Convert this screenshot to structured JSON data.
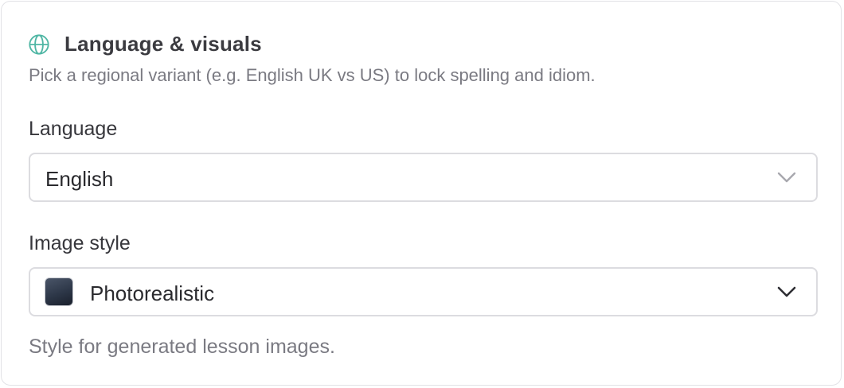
{
  "section": {
    "title": "Language & visuals",
    "subtitle": "Pick a regional variant (e.g. English UK vs US) to lock spelling and idiom.",
    "icon": "globe-icon",
    "accent_color": "#4fb6a4"
  },
  "language": {
    "label": "Language",
    "selected": "English"
  },
  "image_style": {
    "label": "Image style",
    "selected": "Photorealistic",
    "swatch_color": "#2d3748",
    "help": "Style for generated lesson images."
  }
}
